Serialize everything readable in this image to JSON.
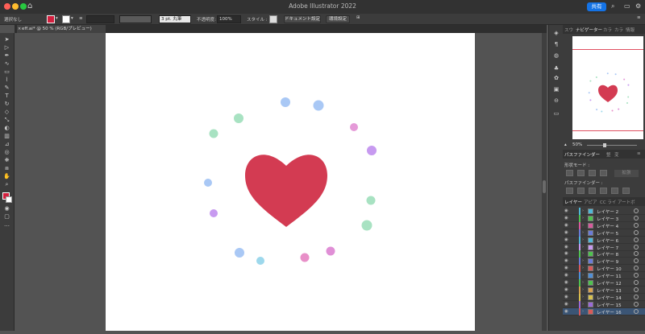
{
  "window": {
    "title": "Adobe Illustrator 2022",
    "share_label": "共有"
  },
  "control_bar": {
    "selection_label": "選択なし",
    "stroke_weight_value": "",
    "brush_value": "3 pt. 丸筆",
    "opacity_label": "不透明度:",
    "opacity_value": "100%",
    "style_label": "スタイル :",
    "doc_setup_label": "ドキュメント設定",
    "prefs_label": "環境設定"
  },
  "document": {
    "tab_label": "eff.ai* @ 50 % (RGB/プレビュー)"
  },
  "artwork": {
    "heart_color": "#d33b52",
    "dots": [
      {
        "color": "#a9c8f5"
      },
      {
        "color": "#a9c8f5"
      },
      {
        "color": "#a8e2c2"
      },
      {
        "color": "#a8e2c2"
      },
      {
        "color": "#e59ad8"
      },
      {
        "color": "#c79af0"
      },
      {
        "color": "#a9c8f5"
      },
      {
        "color": "#a8e2c2"
      },
      {
        "color": "#c79af0"
      },
      {
        "color": "#a8e2c2"
      },
      {
        "color": "#a9c8f5"
      },
      {
        "color": "#9dd8ec"
      },
      {
        "color": "#e88fc8"
      },
      {
        "color": "#e08fd6"
      }
    ]
  },
  "navigator": {
    "tabs": [
      "スウ",
      "ナビゲーター",
      "カラ",
      "カラ",
      "情報"
    ],
    "zoom_value": "50%"
  },
  "pathfinder": {
    "tabs": [
      "パスファインダー",
      "整",
      "変"
    ],
    "shape_mode_label": "形状モード :",
    "expand_label": "拡張",
    "pathfinder_label": "パスファインダー :"
  },
  "layers": {
    "tabs": [
      "レイヤー",
      "アピア",
      "CC ライ",
      "アートボ"
    ],
    "items": [
      {
        "name": "レイヤー 2",
        "color": "#4fb8d8"
      },
      {
        "name": "レイヤー 3",
        "color": "#4fc24f"
      },
      {
        "name": "レイヤー 4",
        "color": "#d85a9c"
      },
      {
        "name": "レイヤー 5",
        "color": "#6a7bd8"
      },
      {
        "name": "レイヤー 6",
        "color": "#4fb8d8"
      },
      {
        "name": "レイヤー 7",
        "color": "#c79af0"
      },
      {
        "name": "レイヤー 8",
        "color": "#4fc24f"
      },
      {
        "name": "レイヤー 9",
        "color": "#6a7bd8"
      },
      {
        "name": "レイヤー 10",
        "color": "#d85a5a"
      },
      {
        "name": "レイヤー 11",
        "color": "#4f8fd8"
      },
      {
        "name": "レイヤー 12",
        "color": "#4fc24f"
      },
      {
        "name": "レイヤー 13",
        "color": "#d8a24f"
      },
      {
        "name": "レイヤー 14",
        "color": "#d8c24f"
      },
      {
        "name": "レイヤー 15",
        "color": "#9a6ad8"
      },
      {
        "name": "レイヤー 16",
        "color": "#d85a5a"
      }
    ]
  }
}
